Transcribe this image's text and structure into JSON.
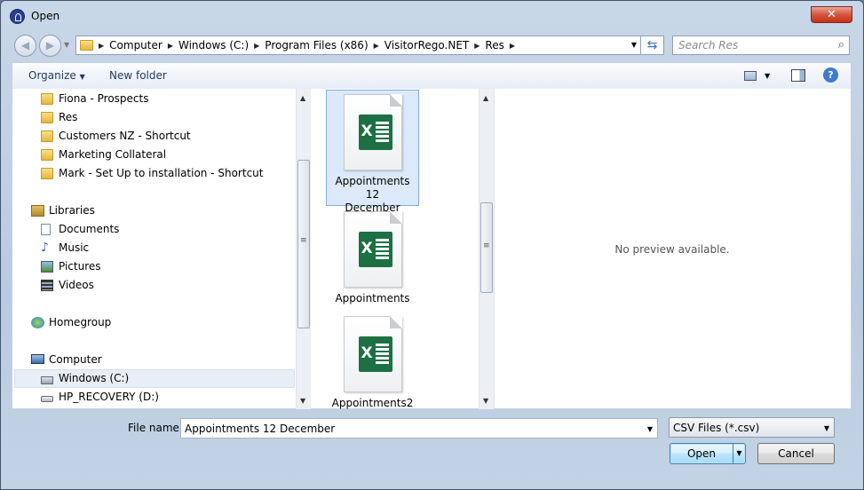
{
  "window": {
    "title": "Open",
    "close_label": "✕"
  },
  "navigation": {
    "back_glyph": "◀",
    "forward_glyph": "▶",
    "breadcrumbs": [
      "Computer",
      "Windows (C:)",
      "Program Files (x86)",
      "VisitorRego.NET",
      "Res"
    ],
    "search_placeholder": "Search Res"
  },
  "toolbar": {
    "organize_label": "Organize",
    "new_folder_label": "New folder",
    "help_label": "?"
  },
  "sidebar": {
    "favorites": [
      {
        "label": "Fiona - Prospects",
        "icon": "folder-icon"
      },
      {
        "label": "Res",
        "icon": "folder-icon"
      },
      {
        "label": "Customers NZ - Shortcut",
        "icon": "folder-icon"
      },
      {
        "label": "Marketing Collateral",
        "icon": "folder-icon"
      },
      {
        "label": "Mark - Set Up to installation - Shortcut",
        "icon": "folder-icon"
      }
    ],
    "libraries_label": "Libraries",
    "libraries": [
      {
        "label": "Documents",
        "icon": "documents-icon"
      },
      {
        "label": "Music",
        "icon": "music-icon"
      },
      {
        "label": "Pictures",
        "icon": "pictures-icon"
      },
      {
        "label": "Videos",
        "icon": "videos-icon"
      }
    ],
    "homegroup_label": "Homegroup",
    "computer_label": "Computer",
    "drives": [
      {
        "label": "Windows (C:)",
        "icon": "drive-icon",
        "selected": true
      },
      {
        "label": "HP_RECOVERY (D:)",
        "icon": "drive-icon",
        "selected": false
      }
    ]
  },
  "files": [
    {
      "line1": "Appointments 12",
      "line2": "December",
      "icon": "excel-csv-icon",
      "selected": true
    },
    {
      "line1": "Appointments",
      "line2": "",
      "icon": "excel-csv-icon",
      "selected": false
    },
    {
      "line1": "Appointments2",
      "line2": "",
      "icon": "excel-csv-icon",
      "selected": false
    }
  ],
  "preview": {
    "message": "No preview available."
  },
  "footer": {
    "file_name_label": "File name:",
    "file_name_value": "Appointments 12 December",
    "filter_value": "CSV Files (*.csv)",
    "open_label": "Open",
    "cancel_label": "Cancel"
  },
  "colors": {
    "close_button": "#c5301b",
    "selection": "#dbe9fa",
    "excel_green": "#1d7044",
    "link_text": "#1e395b"
  }
}
